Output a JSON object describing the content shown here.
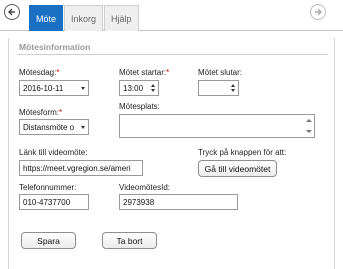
{
  "tabs": [
    {
      "label": "Möte"
    },
    {
      "label": "Inkorg"
    },
    {
      "label": "Hjälp"
    }
  ],
  "section": {
    "title": "Mötesinformation"
  },
  "form": {
    "date_label": "Mötesdag:",
    "date_value": "2016-10-11",
    "start_label": "Mötet startar:",
    "start_value": "13:00",
    "end_label": "Mötet slutar:",
    "end_value": "",
    "form_label": "Mötesform:",
    "form_value": "Distansmöte o",
    "place_label": "Mötesplats:",
    "place_value": "",
    "link_label": "Länk till videomöte:",
    "link_value": "https://meet.vgregion.se/ameri",
    "press_label": "Tryck på knappen för att:",
    "goto_button": "Gå till videomötet",
    "phone_label": "Telefonnummer:",
    "phone_value": "010-4737700",
    "videoid_label": "VideomötesId:",
    "videoid_value": "2973938",
    "required_mark": "*"
  },
  "actions": {
    "save": "Spara",
    "delete": "Ta bort"
  },
  "colors": {
    "active_tab": "#1a6fc2",
    "required": "#cc0000"
  },
  "icons": {
    "back": "circle-arrow-left-icon",
    "forward": "circle-arrow-right-icon"
  }
}
